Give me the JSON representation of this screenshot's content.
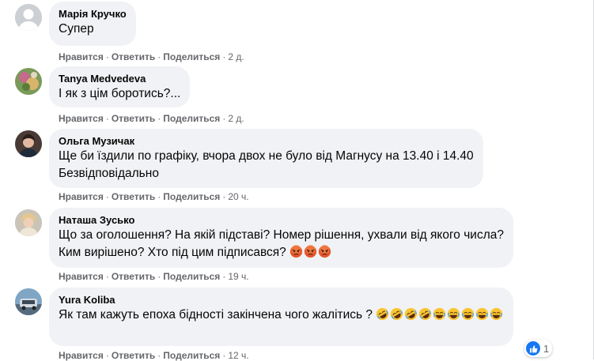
{
  "action_labels": {
    "like": "Нравится",
    "reply": "Ответить",
    "share": "Поделиться"
  },
  "comments": [
    {
      "author": "Марія Кручко",
      "text": "Супер",
      "time": "2 д.",
      "avatar": "default-avatar"
    },
    {
      "author": "Tanya Medvedeva",
      "text": "І як з цім боротись?...",
      "time": "2 д.",
      "avatar": "photo-avatar"
    },
    {
      "author": "Ольга Музичак",
      "text": "Ще би їздили по графіку, вчора двох не було від Магнусу на 13.40 і 14.40\nБезвідповідально",
      "time": "20 ч.",
      "avatar": "photo-avatar"
    },
    {
      "author": "Наташа Зусько",
      "text": "Що за оголошення? На якій підставі? Номер рішення, ухвали від якого числа?\nКим вирішено? Хто під цим підписався?",
      "time": "19 ч.",
      "avatar": "photo-avatar",
      "emoji": [
        "angry-face-icon",
        "angry-face-icon",
        "angry-face-icon"
      ]
    },
    {
      "author": "Yura Koliba",
      "text": "Як там кажуть епоха бідності закінчена чого жалітись ?",
      "time": "12 ч.",
      "avatar": "photo-avatar",
      "emoji": [
        "rolling-laughing-icon",
        "rolling-laughing-icon",
        "rolling-laughing-icon",
        "rolling-laughing-icon",
        "tears-of-joy-icon",
        "tears-of-joy-icon",
        "tears-of-joy-icon",
        "tears-of-joy-icon",
        "tears-of-joy-icon"
      ]
    }
  ],
  "reactions": {
    "icon": "like-icon",
    "count": "1"
  },
  "colors": {
    "bubble": "#f0f2f5",
    "meta": "#65676b",
    "like": "#1877f2"
  }
}
